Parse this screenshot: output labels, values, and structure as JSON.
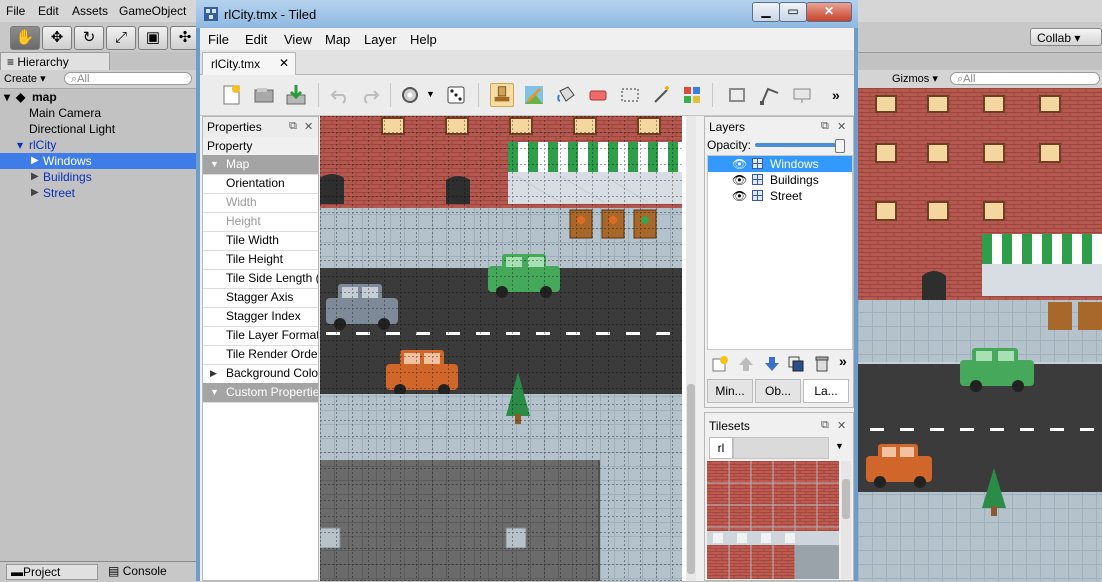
{
  "unity": {
    "menu": [
      "File",
      "Edit",
      "Assets",
      "GameObject"
    ],
    "collab_label": "Collab ▾",
    "hierarchy": {
      "tab": "Hierarchy",
      "create_label": "Create ▾",
      "search_placeholder": "All",
      "items": [
        {
          "label": "map",
          "level": 0,
          "expanded": true
        },
        {
          "label": "Main Camera",
          "level": 1
        },
        {
          "label": "Directional Light",
          "level": 1
        },
        {
          "label": "rlCity",
          "level": 1,
          "expanded": true
        },
        {
          "label": "Windows",
          "level": 2,
          "selected": true
        },
        {
          "label": "Buildings",
          "level": 2
        },
        {
          "label": "Street",
          "level": 2
        }
      ]
    },
    "bottom_tabs": [
      "Project",
      "Console"
    ],
    "scene": {
      "gizmos_label": "Gizmos ▾",
      "search_placeholder": "All"
    }
  },
  "tiled": {
    "title": "rlCity.tmx - Tiled",
    "menu": [
      "File",
      "Edit",
      "View",
      "Map",
      "Layer",
      "Help"
    ],
    "document_tab": "rlCity.tmx",
    "properties": {
      "title": "Properties",
      "column_header": "Property",
      "rows": [
        {
          "label": "Map",
          "kind": "group"
        },
        {
          "label": "Orientation",
          "kind": "normal"
        },
        {
          "label": "Width",
          "kind": "disabled"
        },
        {
          "label": "Height",
          "kind": "disabled"
        },
        {
          "label": "Tile Width",
          "kind": "normal"
        },
        {
          "label": "Tile Height",
          "kind": "normal"
        },
        {
          "label": "Tile Side Length (",
          "kind": "normal"
        },
        {
          "label": "Stagger Axis",
          "kind": "normal"
        },
        {
          "label": "Stagger Index",
          "kind": "normal"
        },
        {
          "label": "Tile Layer Format",
          "kind": "normal"
        },
        {
          "label": "Tile Render Order",
          "kind": "normal"
        },
        {
          "label": "Background Colo",
          "kind": "collapsed"
        },
        {
          "label": "Custom Propertie",
          "kind": "group"
        }
      ]
    },
    "layers": {
      "title": "Layers",
      "opacity_label": "Opacity:",
      "opacity_value": 1.0,
      "items": [
        {
          "label": "Windows",
          "selected": true
        },
        {
          "label": "Buildings",
          "selected": false
        },
        {
          "label": "Street",
          "selected": false
        }
      ],
      "tabs": [
        "Min...",
        "Ob...",
        "La..."
      ]
    },
    "tilesets": {
      "title": "Tilesets",
      "tab": "rl"
    }
  },
  "colors": {
    "selection": "#3399ff",
    "unity_selection": "#3e7de7",
    "brick": "#b5584f",
    "sidewalk": "#b4c2cb",
    "road": "#3b3b3b",
    "car_green": "#46a85a",
    "car_orange": "#d0662a",
    "car_gray": "#7e8a97",
    "awning_green": "#2f9e4a"
  }
}
